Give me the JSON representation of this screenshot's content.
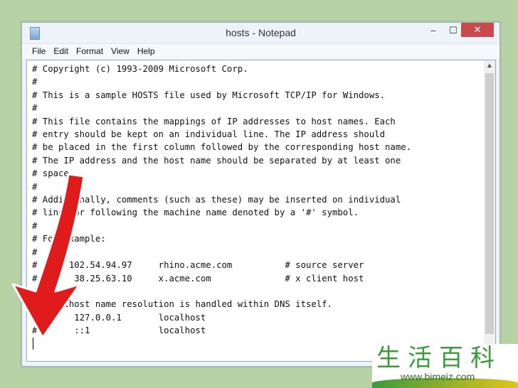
{
  "window": {
    "title": "hosts - Notepad",
    "minimize": "‒",
    "maximize": "☐",
    "close": "✕"
  },
  "menu": [
    "File",
    "Edit",
    "Format",
    "View",
    "Help"
  ],
  "content": "# Copyright (c) 1993-2009 Microsoft Corp.\n#\n# This is a sample HOSTS file used by Microsoft TCP/IP for Windows.\n#\n# This file contains the mappings of IP addresses to host names. Each\n# entry should be kept on an individual line. The IP address should\n# be placed in the first column followed by the corresponding host name.\n# The IP address and the host name should be separated by at least one\n# space.\n#\n# Additionally, comments (such as these) may be inserted on individual\n# lines or following the machine name denoted by a '#' symbol.\n#\n# For example:\n#\n#      102.54.94.97     rhino.acme.com          # source server\n#       38.25.63.10     x.acme.com              # x client host\n\n# localhost name resolution is handled within DNS itself.\n#\t127.0.0.1       localhost\n#\t::1             localhost",
  "watermark": {
    "chars": "生活百科",
    "url": "www.bimeiz.com"
  },
  "colors": {
    "arrow": "#e01b1b",
    "close": "#c94a4a",
    "background": "#b7d2a5"
  }
}
